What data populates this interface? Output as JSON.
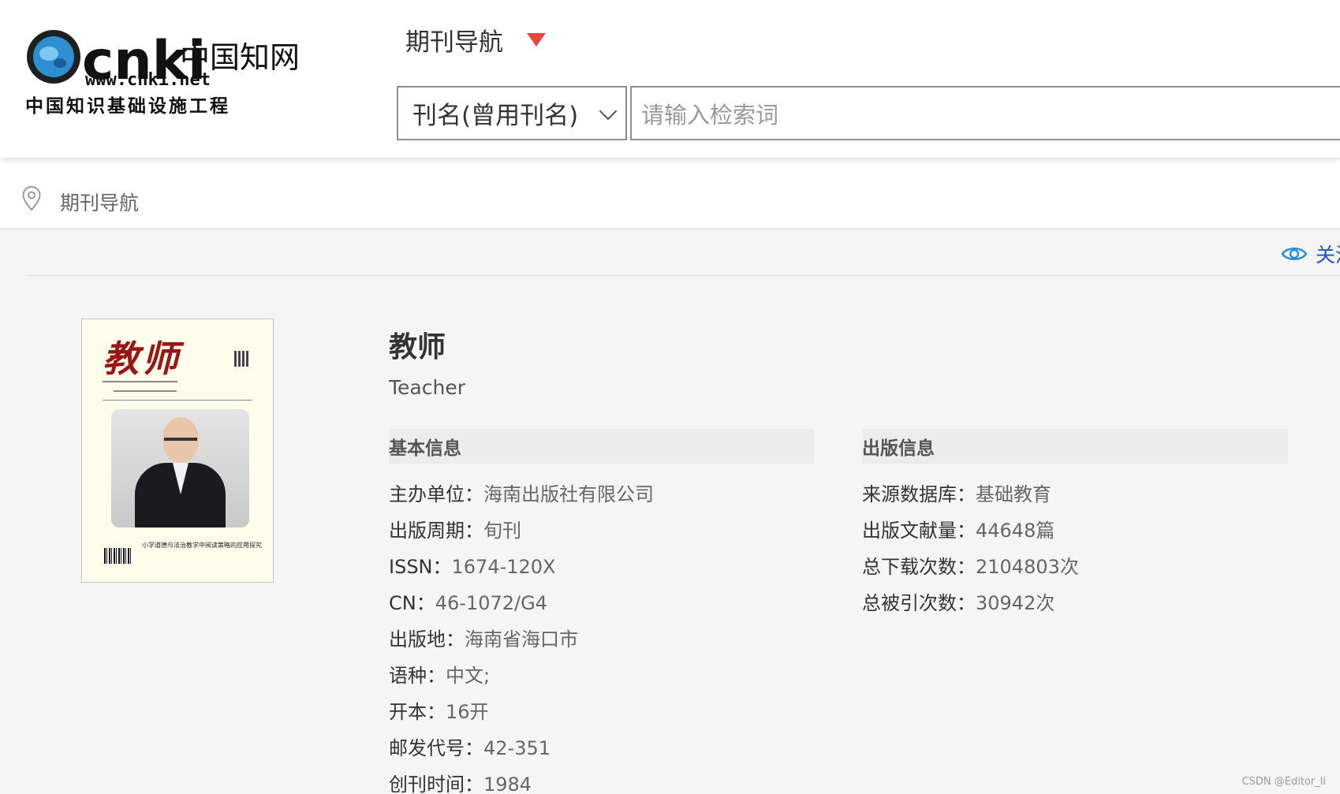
{
  "header": {
    "logo": {
      "brand_text": "cnki",
      "chinese_name": "中国知网",
      "url": "www.cnki.net",
      "subtitle": "中国知识基础设施工程"
    },
    "nav_title": "期刊导航",
    "search": {
      "field_label": "刊名(曾用刊名)",
      "placeholder": "请输入检索词"
    }
  },
  "breadcrumb": {
    "text": "期刊导航"
  },
  "follow": {
    "label": "关注"
  },
  "journal": {
    "cover": {
      "title": "教师",
      "caption": "小学道德与法治教学中阅读策略的应用探究"
    },
    "name": "教师",
    "english_name": "Teacher",
    "basic_info": {
      "heading": "基本信息",
      "fields": [
        {
          "key": "主办单位：",
          "value": "海南出版社有限公司"
        },
        {
          "key": "出版周期：",
          "value": "旬刊"
        },
        {
          "key": "ISSN：",
          "value": "1674-120X"
        },
        {
          "key": "CN：",
          "value": "46-1072/G4"
        },
        {
          "key": "出版地：",
          "value": "海南省海口市"
        },
        {
          "key": "语种：",
          "value": "中文;"
        },
        {
          "key": "开本：",
          "value": "16开"
        },
        {
          "key": "邮发代号：",
          "value": "42-351"
        },
        {
          "key": "创刊时间：",
          "value": "1984"
        }
      ]
    },
    "pub_info": {
      "heading": "出版信息",
      "fields": [
        {
          "key": "来源数据库：",
          "value": "基础教育"
        },
        {
          "key": "出版文献量：",
          "value": "44648篇"
        },
        {
          "key": "总下载次数：",
          "value": "2104803次"
        },
        {
          "key": "总被引次数：",
          "value": "30942次"
        }
      ]
    }
  },
  "watermark": "CSDN @Editor_li",
  "colors": {
    "accent_red": "#e8453c",
    "follow_blue": "#1a56c8",
    "cover_title_red": "#9c1516"
  }
}
